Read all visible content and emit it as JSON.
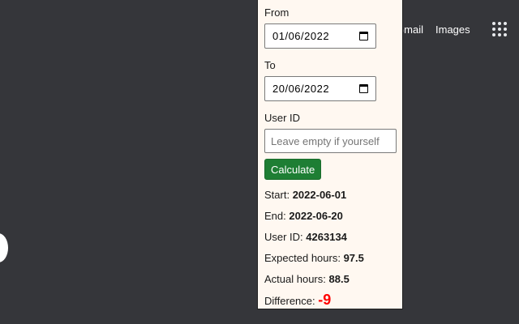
{
  "header": {
    "gmail_label": "Gmail",
    "images_label": "Images",
    "apps_icon": "apps-grid-icon"
  },
  "popup": {
    "from_label": "From",
    "from_value": "01/06/2022",
    "to_label": "To",
    "to_value": "20/06/2022",
    "user_id_label": "User ID",
    "user_id_placeholder": "Leave empty if yourself",
    "calculate_label": "Calculate",
    "results": {
      "start_label": "Start:",
      "start_value": "2022-06-01",
      "end_label": "End:",
      "end_value": "2022-06-20",
      "user_id_label": "User ID:",
      "user_id_value": "4263134",
      "expected_label": "Expected hours:",
      "expected_value": "97.5",
      "actual_label": "Actual hours:",
      "actual_value": "88.5",
      "difference_label": "Difference:",
      "difference_value": "-9"
    }
  },
  "colors": {
    "page_background": "#35363a",
    "popup_background": "#fff8f1",
    "button_green": "#1e7e34",
    "difference_red": "#ff0000"
  }
}
